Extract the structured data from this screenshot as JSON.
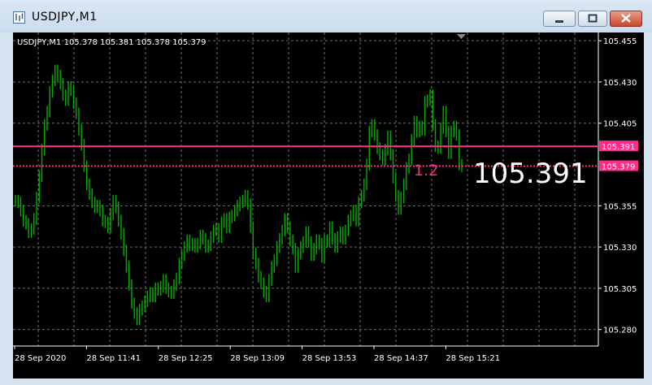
{
  "window": {
    "title": "USDJPY,M1",
    "buttons": [
      "minimize",
      "maximize",
      "close"
    ]
  },
  "info_line": "USDJPY,M1  105.378 105.381 105.378 105.379",
  "big_price": "105.391",
  "line_marker": "1.2",
  "colors": {
    "candles": "#00b000",
    "hline": "#ff2d8a",
    "grid": "#6e6e6e",
    "axis_text": "#ffffff"
  },
  "chart_data": {
    "type": "line",
    "ylim": [
      105.27,
      105.46
    ],
    "y_ticks": [
      "105.455",
      "105.430",
      "105.405",
      "105.355",
      "105.330",
      "105.305",
      "105.280"
    ],
    "x_ticks": [
      "28 Sep 2020",
      "28 Sep 11:41",
      "28 Sep 12:25",
      "28 Sep 13:09",
      "28 Sep 13:53",
      "28 Sep 14:37",
      "28 Sep 15:21"
    ],
    "hlines": [
      {
        "value": 105.391,
        "label": "105.391",
        "style": "solid"
      },
      {
        "value": 105.379,
        "label": "105.379",
        "style": "dotted"
      }
    ],
    "series": [
      {
        "values": [
          105.358,
          105.357,
          105.352,
          105.346,
          105.344,
          105.339,
          105.341,
          105.347,
          105.36,
          105.373,
          105.389,
          105.404,
          105.412,
          105.424,
          105.431,
          105.437,
          105.434,
          105.429,
          105.422,
          105.419,
          105.427,
          105.425,
          105.417,
          105.411,
          105.401,
          105.392,
          105.379,
          105.368,
          105.362,
          105.357,
          105.354,
          105.355,
          105.352,
          105.346,
          105.345,
          105.342,
          105.35,
          105.358,
          105.354,
          105.346,
          105.338,
          105.328,
          105.318,
          105.307,
          105.296,
          105.29,
          105.286,
          105.292,
          105.294,
          105.297,
          105.3,
          105.302,
          105.3,
          105.305,
          105.304,
          105.306,
          105.31,
          105.305,
          105.303,
          105.302,
          105.307,
          105.311,
          105.32,
          105.325,
          105.33,
          105.334,
          105.331,
          105.332,
          105.33,
          105.332,
          105.337,
          105.335,
          105.33,
          105.331,
          105.336,
          105.34,
          105.341,
          105.336,
          105.345,
          105.347,
          105.342,
          105.348,
          105.349,
          105.352,
          105.355,
          105.357,
          105.358,
          105.361,
          105.356,
          105.342,
          105.326,
          105.32,
          105.312,
          105.308,
          105.303,
          105.3,
          105.31,
          105.318,
          105.322,
          105.33,
          105.335,
          105.34,
          105.347,
          105.342,
          105.334,
          105.329,
          105.318,
          105.326,
          105.33,
          105.333,
          105.339,
          105.333,
          105.325,
          105.329,
          105.334,
          105.332,
          105.324,
          105.334,
          105.333,
          105.342,
          105.335,
          105.33,
          105.336,
          105.339,
          105.335,
          105.34,
          105.346,
          105.349,
          105.352,
          105.346,
          105.357,
          105.361,
          105.368,
          105.38,
          105.4,
          105.404,
          105.398,
          105.39,
          105.386,
          105.383,
          105.389,
          105.397,
          105.386,
          105.372,
          105.361,
          105.353,
          105.36,
          105.368,
          105.378,
          105.383,
          105.395,
          105.406,
          105.4,
          105.403,
          105.401,
          105.418,
          105.419,
          105.422,
          105.404,
          105.391,
          105.39,
          105.402,
          105.412,
          105.4,
          105.387,
          105.4,
          105.403,
          105.398,
          105.38,
          105.379
        ]
      }
    ]
  }
}
